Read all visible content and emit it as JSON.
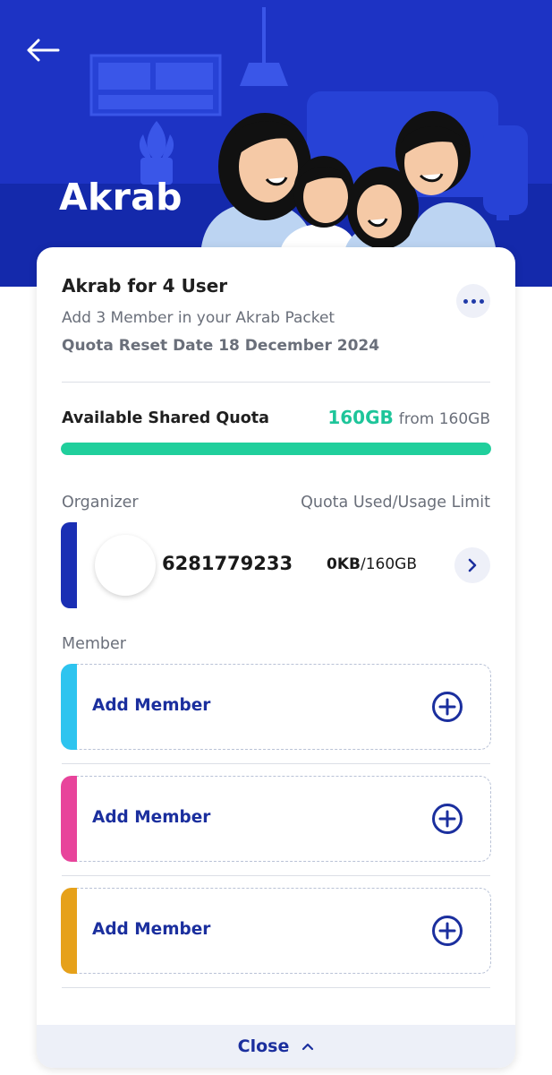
{
  "header": {
    "title": "Akrab",
    "back_icon": "arrow-left-icon"
  },
  "package": {
    "name": "Akrab for 4 User",
    "subtitle": "Add 3 Member in your Akrab Packet",
    "reset_date": "Quota Reset Date 18 December 2024"
  },
  "quota": {
    "label": "Available Shared Quota",
    "remaining": "160GB",
    "total_text": "from 160GB",
    "fill_percent": 100
  },
  "organizer": {
    "column_left": "Organizer",
    "column_right": "Quota Used/Usage Limit",
    "number": "6281779233",
    "usage_used": "0KB",
    "usage_limit": "/160GB"
  },
  "members": {
    "label": "Member",
    "slots": [
      {
        "label": "Add Member",
        "color": "#2ec4ef"
      },
      {
        "label": "Add Member",
        "color": "#e8449b"
      },
      {
        "label": "Add Member",
        "color": "#e6a11a"
      }
    ]
  },
  "footer": {
    "close_label": "Close"
  },
  "colors": {
    "brand_blue": "#1d33c4",
    "accent_green": "#20cf9c",
    "link_blue": "#1b2f9e"
  }
}
